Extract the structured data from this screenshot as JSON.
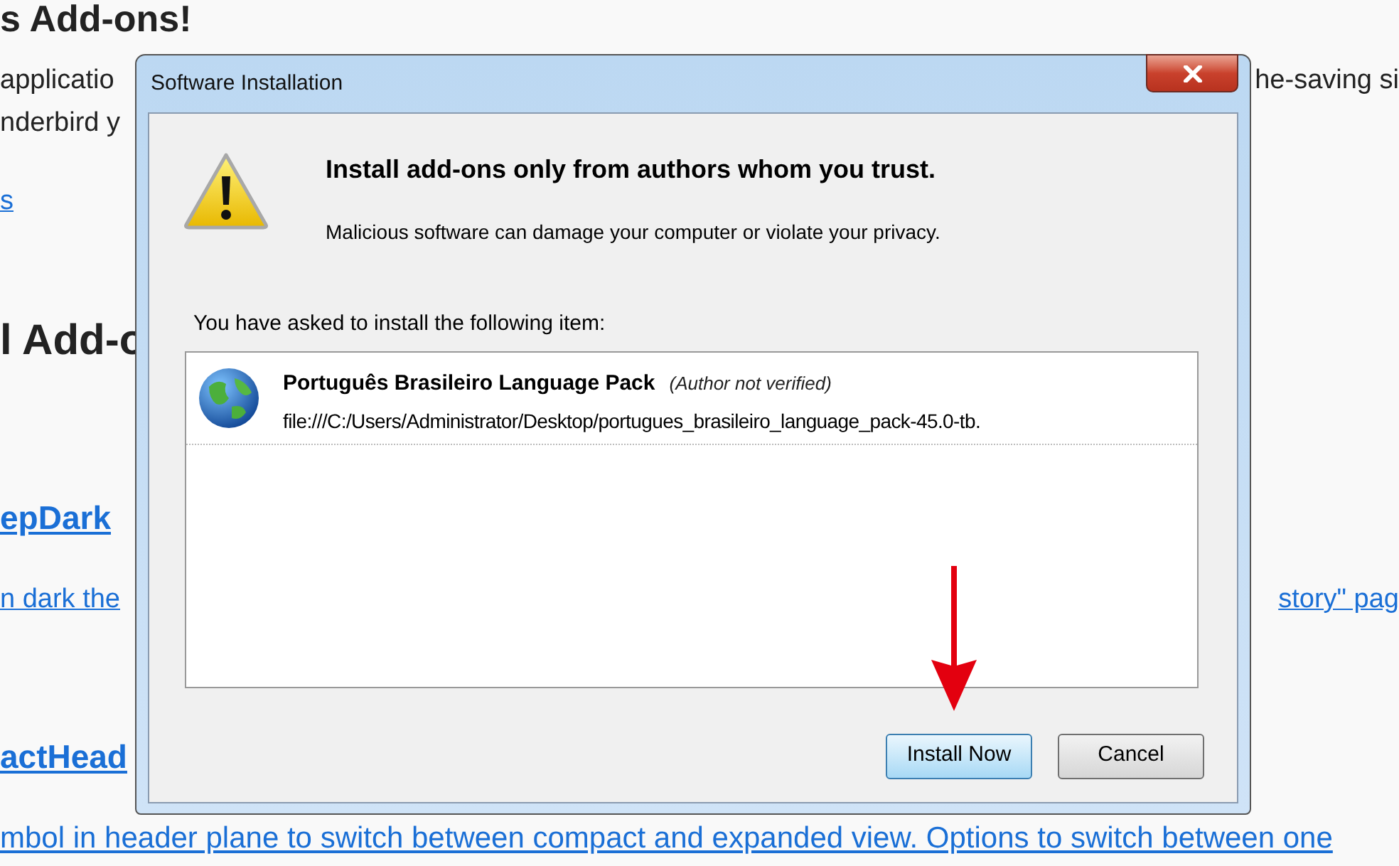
{
  "background_page": {
    "heading": "s Add-ons!",
    "intro_lines": [
      {
        "left": "applicatio",
        "right": "he-saving si"
      },
      {
        "left": "nderbird y"
      }
    ],
    "link": "s",
    "section_heading": "l Add-o",
    "addons": [
      {
        "name": "epDark",
        "description_left": "n dark the",
        "description_right": "story\" pag"
      },
      {
        "name": "actHead",
        "description_left": "mbol in header plane to switch between compact and expanded view. Options to switch between one"
      }
    ]
  },
  "dialog": {
    "title": "Software Installation",
    "warning_heading": "Install add-ons only from authors whom you trust.",
    "warning_message": "Malicious software can damage your computer or violate your privacy.",
    "list_label": "You have asked to install the following item:",
    "items": [
      {
        "name": "Português Brasileiro Language Pack",
        "note": "(Author not verified)",
        "url": "file:///C:/Users/Administrator/Desktop/portugues_brasileiro_language_pack-45.0-tb."
      }
    ],
    "buttons": [
      {
        "label": "Install Now",
        "focused": true
      },
      {
        "label": "Cancel",
        "focused": false
      }
    ]
  }
}
